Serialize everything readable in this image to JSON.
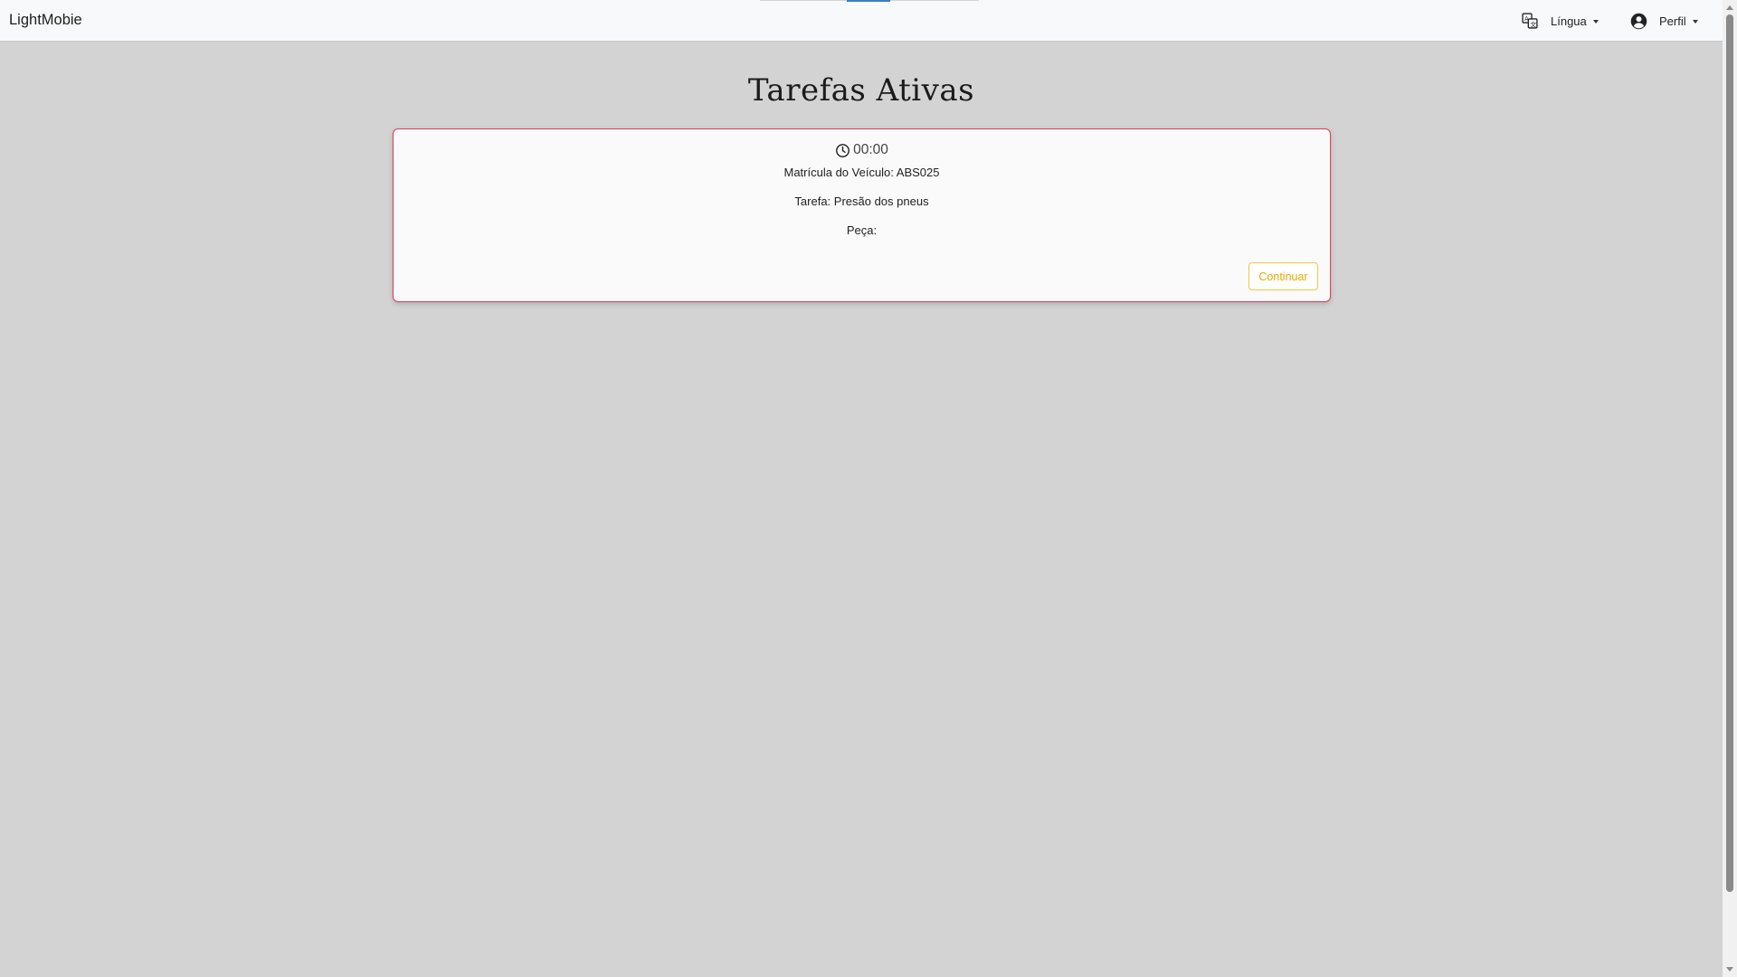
{
  "app": {
    "brand": "LightMobie"
  },
  "nav": {
    "language_label": "Língua",
    "language_icon": "translate-icon",
    "profile_label": "Perfil",
    "profile_icon": "account-circle-icon"
  },
  "page": {
    "title": "Tarefas Ativas"
  },
  "task": {
    "timer": "00:00",
    "timer_icon": "clock-icon",
    "vehicle_plate": "Matrícula do Veículo: ABS025",
    "task_name": "Tarefa: Presão dos pneus",
    "part": "Peça:",
    "continue_label": "Continuar"
  },
  "colors": {
    "card_border": "#e23a55",
    "button_accent": "#f5c542",
    "page_background": "#d3d3d3",
    "navbar_background": "#f8f9fa"
  }
}
